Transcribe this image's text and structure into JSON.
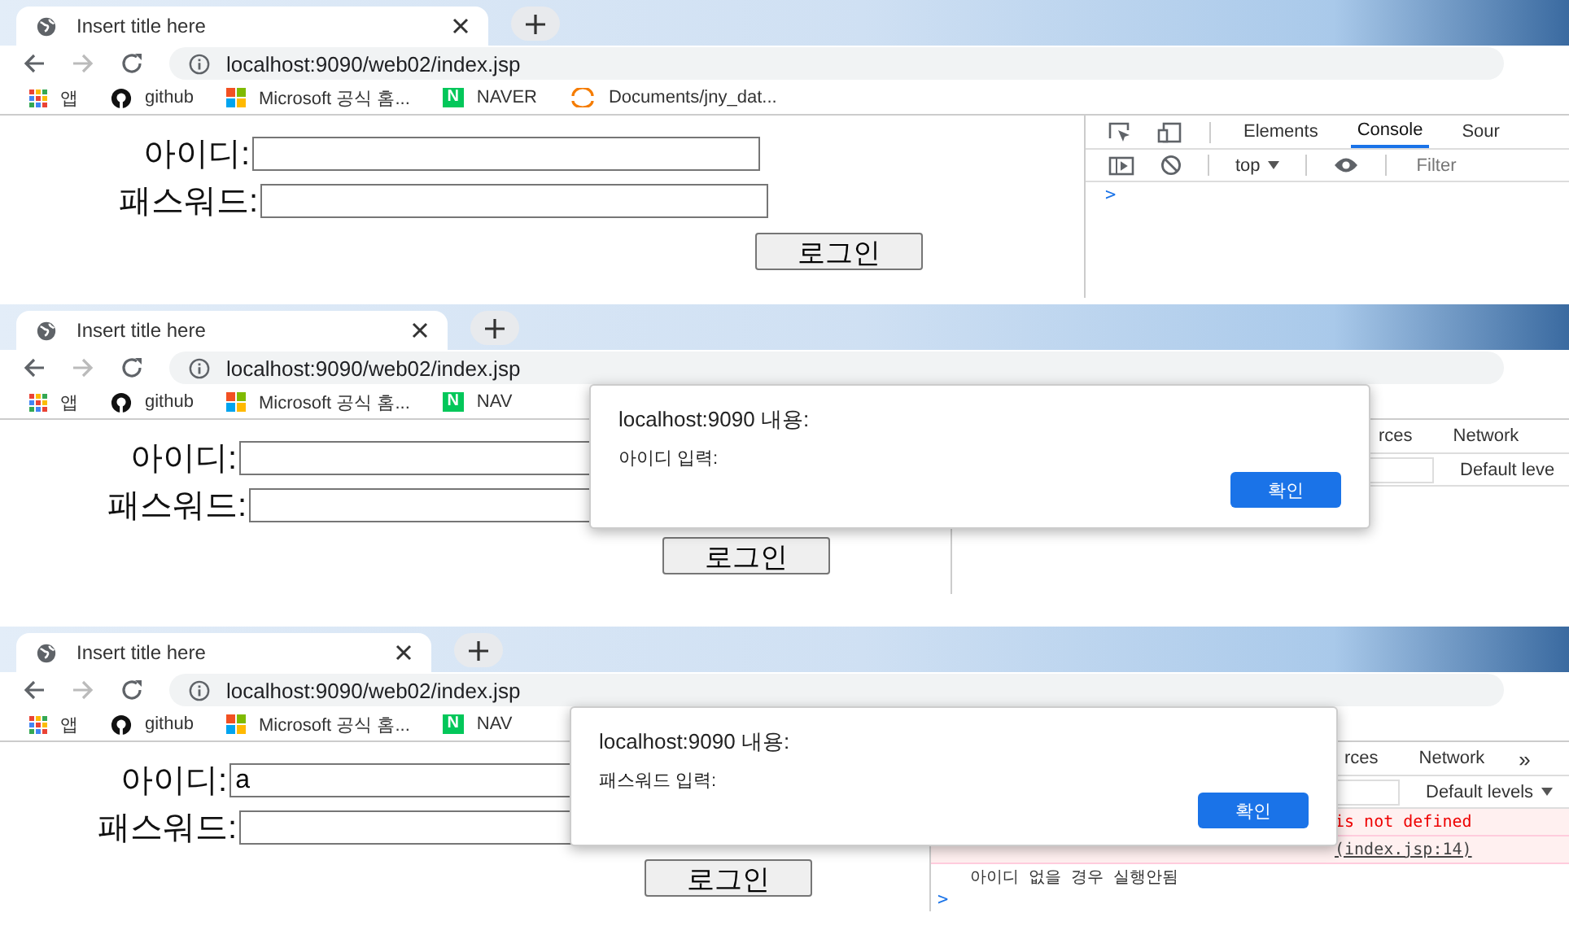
{
  "panels": [
    {
      "tab": {
        "title": "Insert title here"
      },
      "url": "localhost:9090/web02/index.jsp",
      "bookmarks": [
        {
          "kind": "apps",
          "label": "앱"
        },
        {
          "kind": "github",
          "label": "github"
        },
        {
          "kind": "microsoft",
          "label": "Microsoft 공식 홈..."
        },
        {
          "kind": "naver",
          "badge": "N",
          "label": "NAVER"
        },
        {
          "kind": "documents",
          "label": "Documents/jny_dat..."
        }
      ],
      "form": {
        "id_label": "아이디:",
        "pw_label": "패스워드:",
        "login_button": "로그인"
      },
      "devtools": {
        "kind": "full",
        "tabs": [
          {
            "label": "Elements",
            "selected": false
          },
          {
            "label": "Console",
            "selected": true
          },
          {
            "label": "Sour",
            "selected": false
          }
        ],
        "context": "top",
        "filter_placeholder": "Filter",
        "console": [
          {
            "kind": "prompt",
            "text": ">"
          }
        ]
      }
    },
    {
      "tab": {
        "title": "Insert title here"
      },
      "url": "localhost:9090/web02/index.jsp",
      "bookmarks": [
        {
          "kind": "apps",
          "label": "앱"
        },
        {
          "kind": "github",
          "label": "github"
        },
        {
          "kind": "microsoft",
          "label": "Microsoft 공식 홈..."
        },
        {
          "kind": "naver",
          "badge": "N",
          "label": "NAV"
        }
      ],
      "form": {
        "id_label": "아이디:",
        "pw_label": "패스워드:",
        "login_button": "로그인"
      },
      "devtools": {
        "kind": "partial",
        "tabs": [
          {
            "label": "rces",
            "selected": false
          },
          {
            "label": "Network",
            "selected": false
          }
        ],
        "levels": "Default leve"
      },
      "dialog": {
        "title": "localhost:9090 내용:",
        "message": "아이디 입력:",
        "ok": "확인"
      }
    },
    {
      "tab": {
        "title": "Insert title here"
      },
      "url": "localhost:9090/web02/index.jsp",
      "bookmarks": [
        {
          "kind": "apps",
          "label": "앱"
        },
        {
          "kind": "github",
          "label": "github"
        },
        {
          "kind": "microsoft",
          "label": "Microsoft 공식 홈..."
        },
        {
          "kind": "naver",
          "badge": "N",
          "label": "NAV"
        }
      ],
      "form": {
        "id_label": "아이디:",
        "id_value": "a",
        "pw_label": "패스워드:",
        "login_button": "로그인"
      },
      "devtools": {
        "kind": "partial",
        "tabs": [
          {
            "label": "rces",
            "selected": false
          },
          {
            "label": "Network",
            "selected": false
          }
        ],
        "more": "»",
        "levels": "Default levels",
        "console": [
          {
            "kind": "error",
            "text": "is not defined"
          },
          {
            "kind": "source-link",
            "text": "(index.jsp:14)"
          },
          {
            "kind": "log",
            "text": "아이디 없을 경우 실행안됨"
          },
          {
            "kind": "prompt",
            "text": ">"
          }
        ]
      },
      "dialog": {
        "title": "localhost:9090 내용:",
        "message": "패스워드 입력:",
        "ok": "확인"
      }
    }
  ]
}
